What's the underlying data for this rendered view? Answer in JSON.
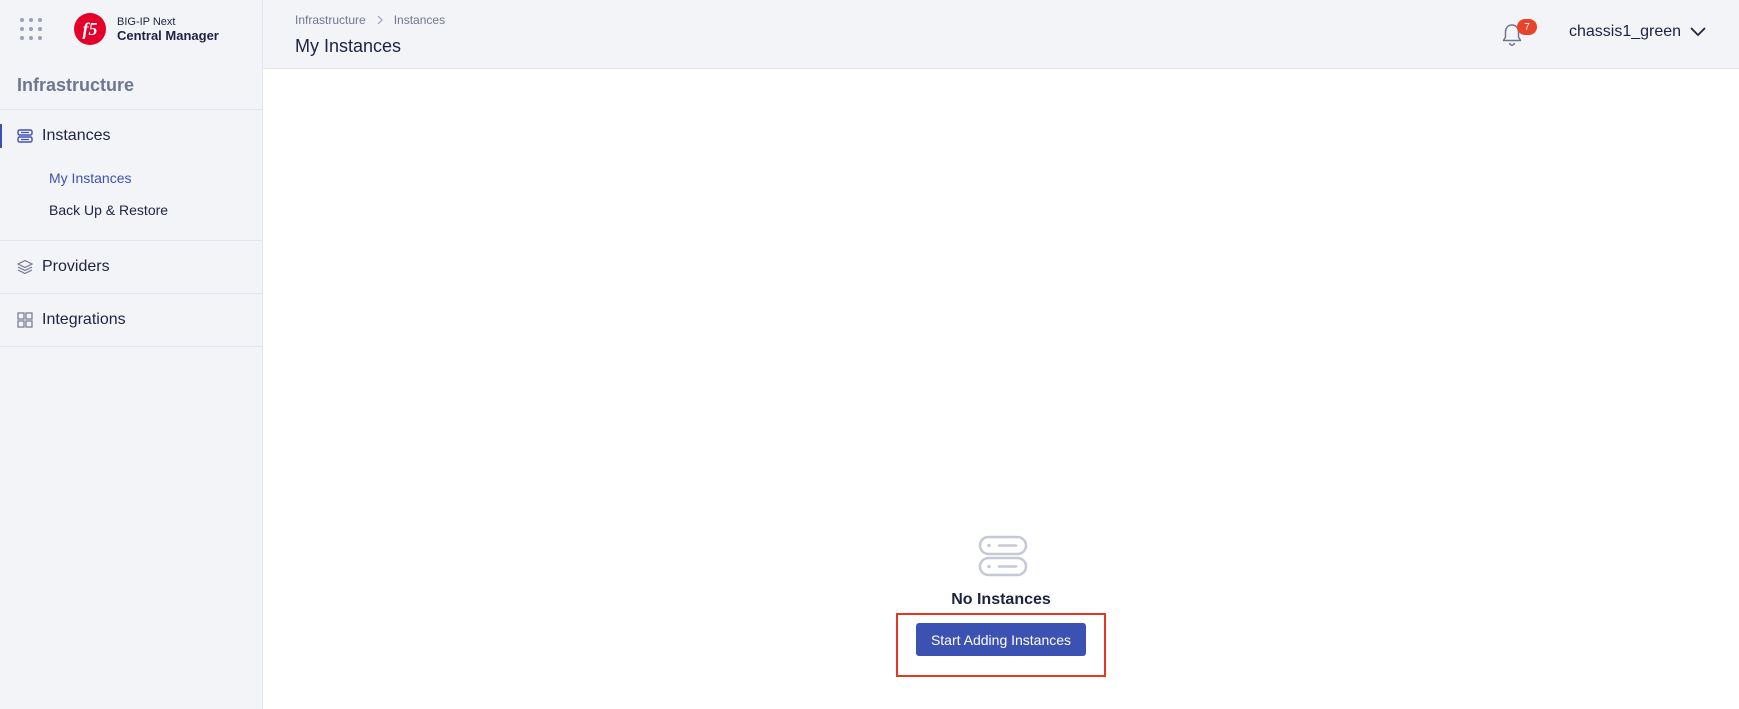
{
  "brand": {
    "line1": "BIG-IP Next",
    "line2": "Central Manager",
    "logo_icon": "f5-logo"
  },
  "sidebar": {
    "section_title": "Infrastructure",
    "items": [
      {
        "label": "Instances",
        "icon": "server-icon",
        "active": true,
        "subitems": [
          {
            "label": "My Instances",
            "selected": true
          },
          {
            "label": "Back Up & Restore"
          }
        ]
      },
      {
        "label": "Providers",
        "icon": "layers-icon"
      },
      {
        "label": "Integrations",
        "icon": "grid-icon"
      }
    ]
  },
  "header": {
    "breadcrumb": [
      "Infrastructure",
      "Instances"
    ],
    "title": "My Instances",
    "notification_count": "7",
    "account_name": "chassis1_green"
  },
  "empty_state": {
    "title": "No Instances",
    "button_label": "Start Adding Instances"
  },
  "colors": {
    "accent": "#3c52b2",
    "badge": "#e8442c",
    "highlight": "#e8361f",
    "brand": "#e4002b"
  }
}
